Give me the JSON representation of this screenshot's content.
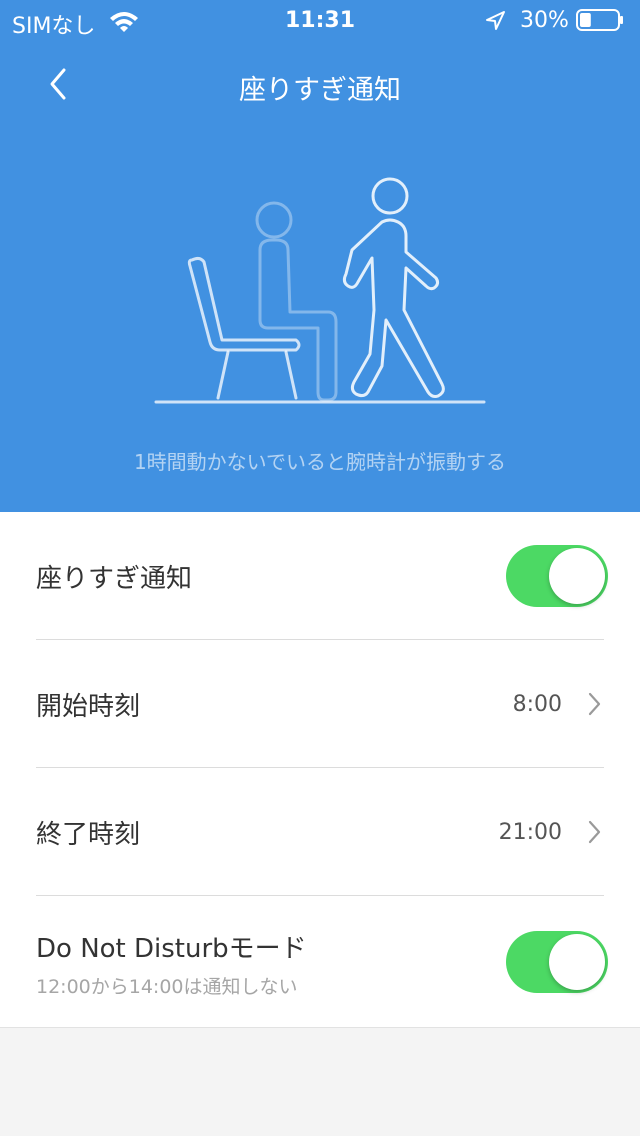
{
  "status_bar": {
    "carrier": "SIMなし",
    "time": "11:31",
    "battery": "30%",
    "battery_level": 0.3,
    "icons": [
      "wifi-icon",
      "location-arrow-icon",
      "battery-icon"
    ]
  },
  "nav": {
    "title": "座りすぎ通知",
    "back_icon": "chevron-left-icon"
  },
  "hero": {
    "illustration": "sitting-and-walking-figures",
    "caption": "1時間動かないでいると腕時計が振動する"
  },
  "settings": {
    "sedentary": {
      "label": "座りすぎ通知",
      "enabled": true
    },
    "start_time": {
      "label": "開始時刻",
      "value": "8:00"
    },
    "end_time": {
      "label": "終了時刻",
      "value": "21:00"
    },
    "dnd": {
      "label": "Do Not Disturbモード",
      "sub": "12:00から14:00は通知しない",
      "enabled": true
    }
  },
  "colors": {
    "header": "#4191e1",
    "toggle_on": "#4cd964",
    "background": "#f4f4f4"
  }
}
